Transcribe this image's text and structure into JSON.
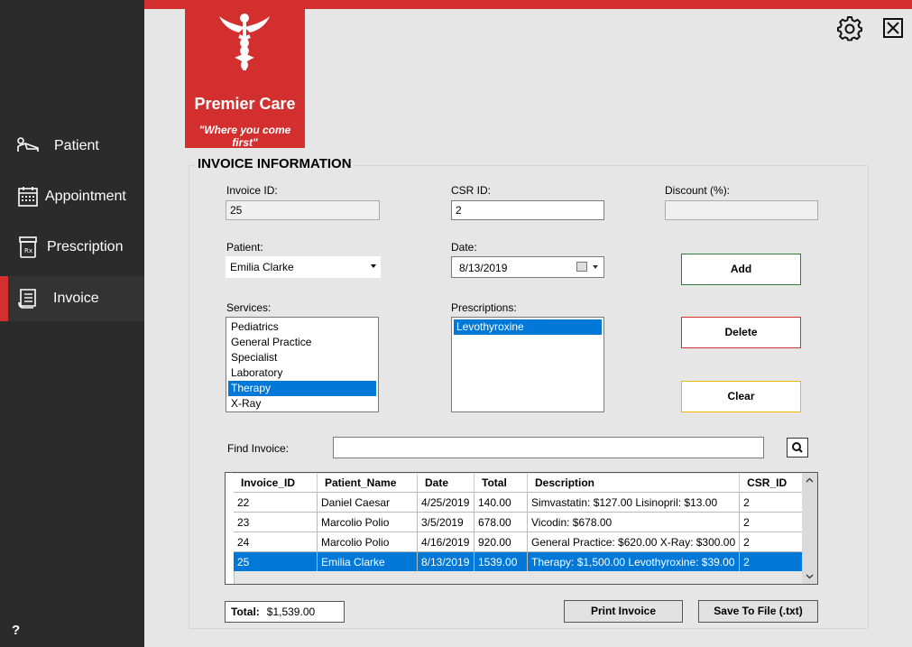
{
  "sidebar": {
    "items": [
      {
        "label": "Patient",
        "icon": "patient-bed-icon"
      },
      {
        "label": "Appointment",
        "icon": "calendar-icon"
      },
      {
        "label": "Prescription",
        "icon": "pill-bottle-icon"
      },
      {
        "label": "Invoice",
        "icon": "invoice-icon"
      }
    ],
    "active": "Invoice",
    "help_label": "?"
  },
  "brand": {
    "name": "Premier Care",
    "tagline": "\"Where you come first\"",
    "color": "#d32f2f"
  },
  "section_title": "INVOICE INFORMATION",
  "form": {
    "invoice_id_label": "Invoice ID:",
    "invoice_id_value": "25",
    "csr_id_label": "CSR ID:",
    "csr_id_value": "2",
    "discount_label": "Discount (%):",
    "discount_value": "",
    "patient_label": "Patient:",
    "patient_value": "Emilia Clarke",
    "date_label": "Date:",
    "date_value": "8/13/2019",
    "services_label": "Services:",
    "services": [
      "Pediatrics",
      "General Practice",
      "Specialist",
      "Laboratory",
      "Therapy",
      "X-Ray"
    ],
    "services_selected": "Therapy",
    "prescriptions_label": "Prescriptions:",
    "prescriptions": [
      "Levothyroxine"
    ],
    "prescriptions_selected": "Levothyroxine"
  },
  "buttons": {
    "add": "Add",
    "delete": "Delete",
    "clear": "Clear",
    "print": "Print Invoice",
    "save": "Save To File (.txt)"
  },
  "find": {
    "label": "Find Invoice:",
    "value": ""
  },
  "grid": {
    "columns": [
      "Invoice_ID",
      "Patient_Name",
      "Date",
      "Total",
      "Description",
      "CSR_ID"
    ],
    "rows": [
      [
        "22",
        "Daniel Caesar",
        "4/25/2019",
        "140.00",
        "Simvastatin: $127.00 Lisinopril: $13.00",
        "2"
      ],
      [
        "23",
        "Marcolio Polio",
        "3/5/2019",
        "678.00",
        "Vicodin: $678.00",
        "2"
      ],
      [
        "24",
        "Marcolio Polio",
        "4/16/2019",
        "920.00",
        "General Practice: $620.00 X-Ray: $300.00",
        "2"
      ],
      [
        "25",
        "Emilia Clarke",
        "8/13/2019",
        "1539.00",
        "Therapy: $1,500.00 Levothyroxine: $39.00",
        "2"
      ]
    ],
    "selected_row": 3
  },
  "total": {
    "label": "Total:",
    "value": "$1,539.00"
  },
  "colors": {
    "accent": "#d32f2f",
    "sidebar_bg": "#2b2b2b",
    "selection": "#0078d7",
    "add_border": "#2e7d32",
    "clear_border": "#f1b600"
  }
}
